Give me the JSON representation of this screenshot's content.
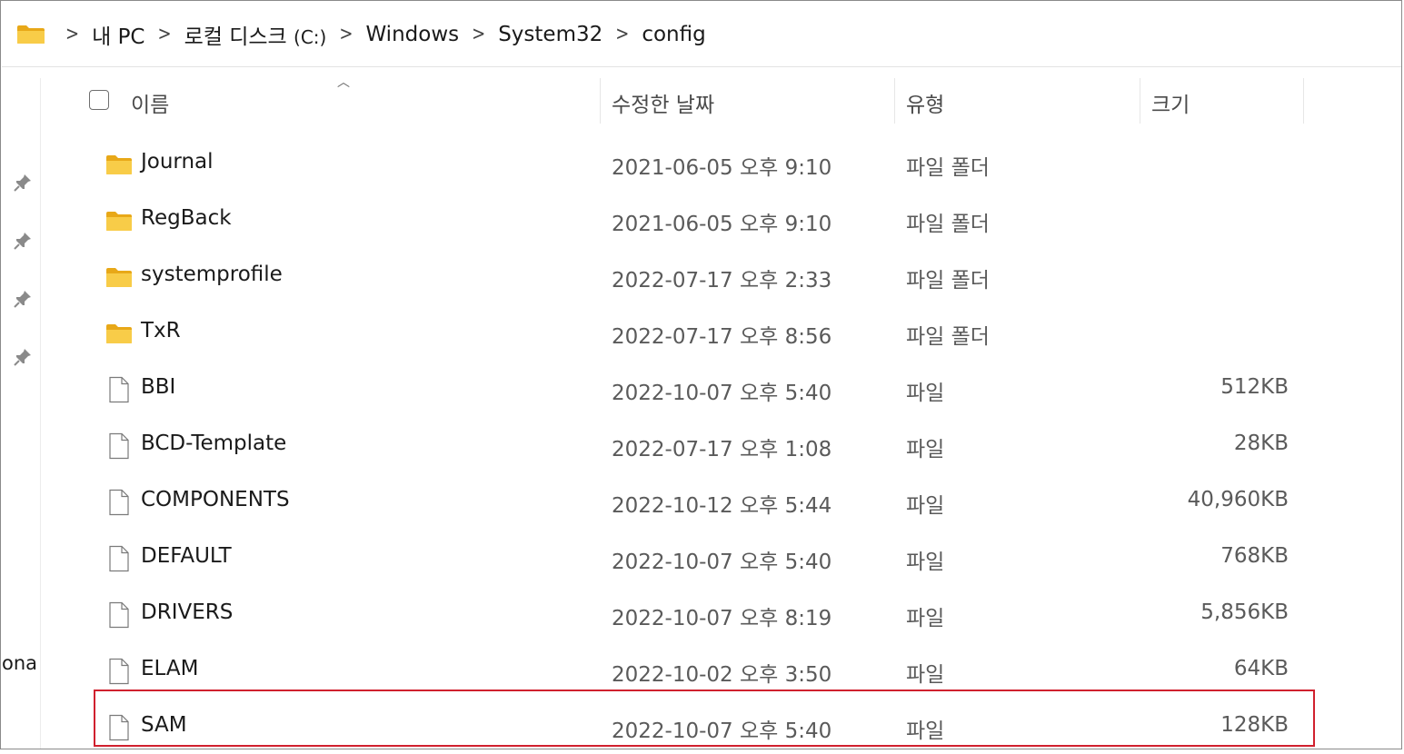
{
  "breadcrumb": {
    "items": [
      "내 PC",
      "로컬 디스크",
      "Windows",
      "System32",
      "config"
    ],
    "drive_suffix": "(C:)"
  },
  "left_pane": {
    "truncated_text": "ona"
  },
  "columns": {
    "name": "이름",
    "date": "수정한 날짜",
    "type": "유형",
    "size": "크기"
  },
  "files": [
    {
      "name": "Journal",
      "date": "2021-06-05 오후 9:10",
      "type": "파일 폴더",
      "size": "",
      "icon": "folder-icon"
    },
    {
      "name": "RegBack",
      "date": "2021-06-05 오후 9:10",
      "type": "파일 폴더",
      "size": "",
      "icon": "folder-icon"
    },
    {
      "name": "systemprofile",
      "date": "2022-07-17 오후 2:33",
      "type": "파일 폴더",
      "size": "",
      "icon": "folder-icon"
    },
    {
      "name": "TxR",
      "date": "2022-07-17 오후 8:56",
      "type": "파일 폴더",
      "size": "",
      "icon": "folder-icon"
    },
    {
      "name": "BBI",
      "date": "2022-10-07 오후 5:40",
      "type": "파일",
      "size": "512KB",
      "icon": "file-icon"
    },
    {
      "name": "BCD-Template",
      "date": "2022-07-17 오후 1:08",
      "type": "파일",
      "size": "28KB",
      "icon": "file-icon"
    },
    {
      "name": "COMPONENTS",
      "date": "2022-10-12 오후 5:44",
      "type": "파일",
      "size": "40,960KB",
      "icon": "file-icon"
    },
    {
      "name": "DEFAULT",
      "date": "2022-10-07 오후 5:40",
      "type": "파일",
      "size": "768KB",
      "icon": "file-icon"
    },
    {
      "name": "DRIVERS",
      "date": "2022-10-07 오후 8:19",
      "type": "파일",
      "size": "5,856KB",
      "icon": "file-icon"
    },
    {
      "name": "ELAM",
      "date": "2022-10-02 오후 3:50",
      "type": "파일",
      "size": "64KB",
      "icon": "file-icon"
    },
    {
      "name": "SAM",
      "date": "2022-10-07 오후 5:40",
      "type": "파일",
      "size": "128KB",
      "icon": "file-icon"
    }
  ],
  "colors": {
    "highlight": "#d0202e",
    "folder": "#f5c842"
  }
}
